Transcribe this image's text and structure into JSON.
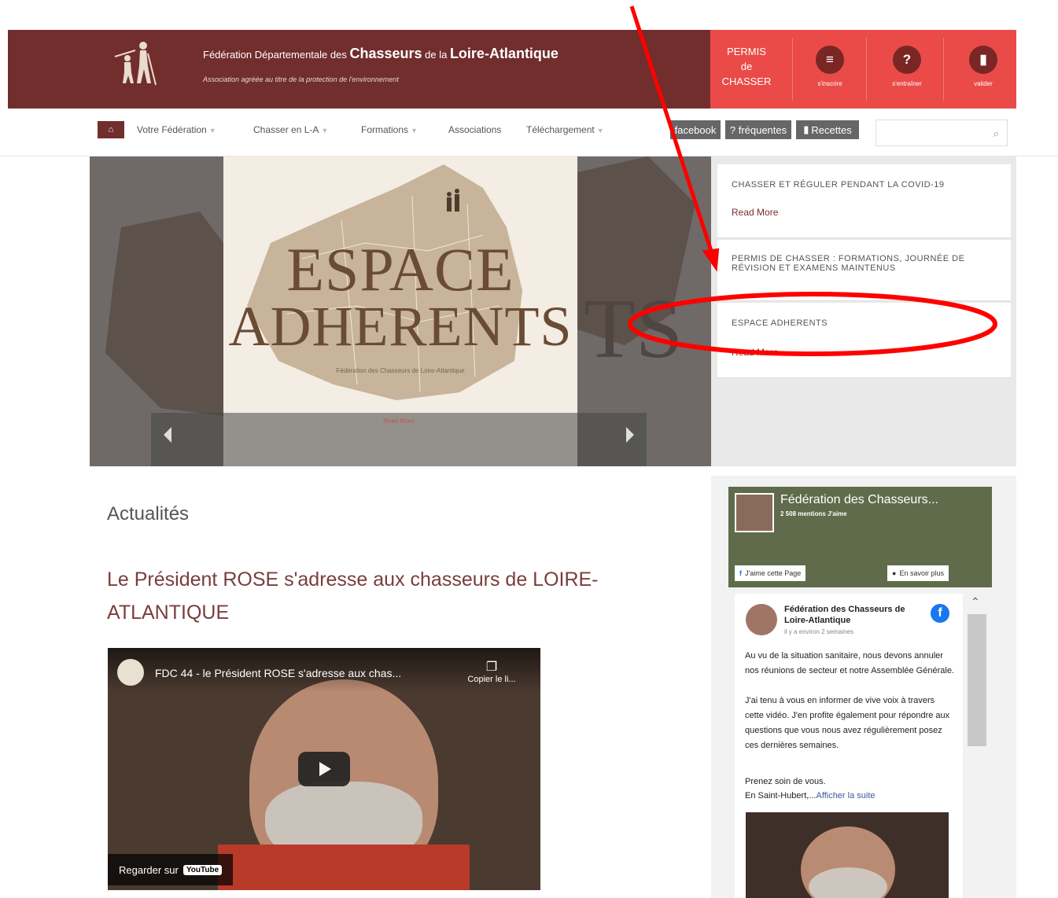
{
  "header": {
    "title_prefix": "Fédération Départementale des ",
    "title_main": "Chasseurs",
    "title_mid": " de la ",
    "title_region": "Loire-Atlantique",
    "tagline": "Association agréée au titre de la protection de l'environnement",
    "permis_lines": [
      "PERMIS",
      "de",
      "CHASSER"
    ],
    "actions": [
      {
        "icon": "≡",
        "label": "s'inscrire"
      },
      {
        "icon": "?",
        "label": "s'entraîner"
      },
      {
        "icon": "▮",
        "label": "valider"
      }
    ]
  },
  "nav": {
    "home_icon": "⌂",
    "items": [
      "Votre Fédération",
      "Chasser en L-A",
      "Formations",
      "Associations",
      "Téléchargement"
    ],
    "buttons": [
      "facebook",
      "? fréquentes",
      "Recettes"
    ],
    "search_icon": "🔍"
  },
  "slider": {
    "title_line1": "ESPACE",
    "title_line2": "ADHERENTS",
    "caption": "Fédération des Chasseurs de Loire-Atlantique",
    "link": "Read More",
    "side_text": "TS"
  },
  "news": [
    {
      "title": "CHASSER ET RÉGULER PENDANT LA COVID-19",
      "read": "Read More"
    },
    {
      "title": "PERMIS DE CHASSER : FORMATIONS, JOURNÉE DE RÉVISION ET EXAMENS MAINTENUS",
      "read": ""
    },
    {
      "title": "ESPACE ADHERENTS",
      "read": "Read More"
    }
  ],
  "main": {
    "section_title": "Actualités",
    "article_title": "Le Président ROSE s'adresse aux chasseurs de LOIRE-ATLANTIQUE",
    "video": {
      "title": "FDC 44 - le Président ROSE s'adresse aux chas...",
      "copy": "Copier le li...",
      "watch": "Regarder sur",
      "yt": "YouTube"
    }
  },
  "facebook": {
    "page_name": "Fédération des Chasseurs...",
    "likes": "2 508 mentions J'aime",
    "like_btn": "J'aime cette Page",
    "more_btn": "En savoir plus",
    "post_author": "Fédération des Chasseurs de Loire-Atlantique",
    "post_time": "il y a environ 2 semaines",
    "post_text1": "Au vu de la situation sanitaire, nous devons annuler nos réunions de secteur et notre Assemblée Générale.",
    "post_text2": "J'ai tenu à vous en informer de vive voix à travers cette vidéo. J'en profite également pour répondre aux questions que vous nous avez régulièrement posez ces dernières semaines.",
    "post_text3": "Prenez soin de vous.",
    "post_text4": "En Saint-Hubert,...",
    "post_more": "Afficher la suite"
  }
}
